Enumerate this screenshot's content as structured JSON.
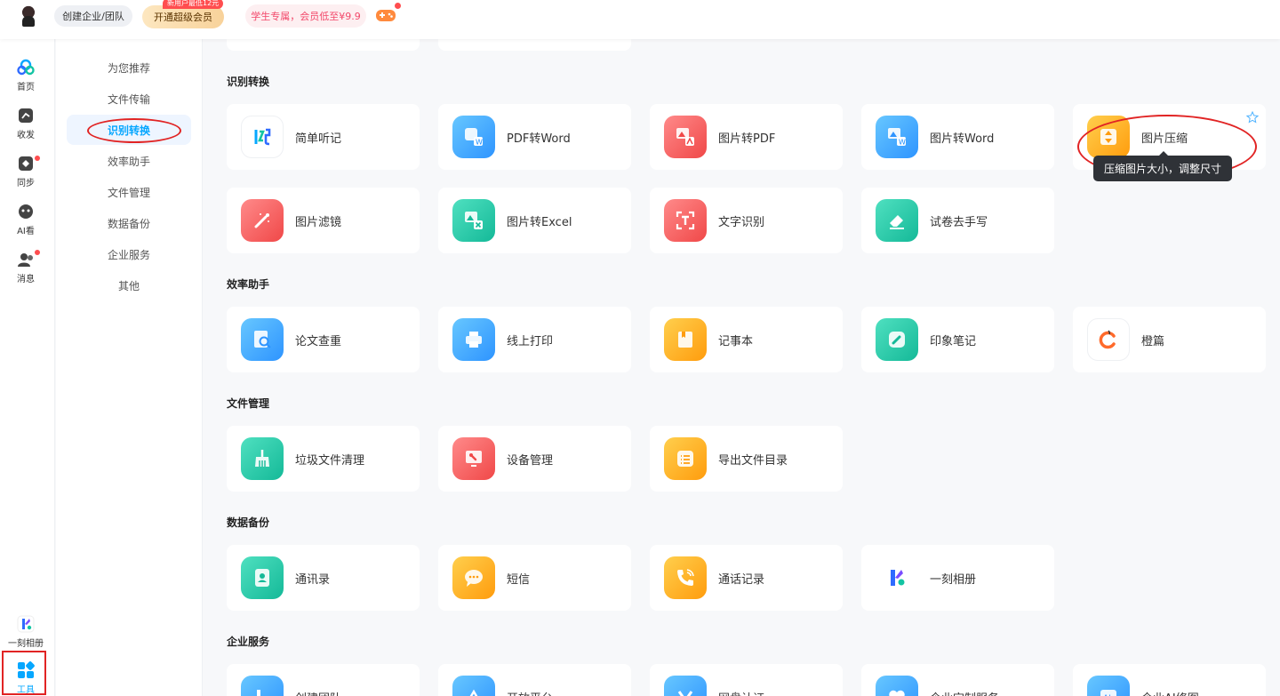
{
  "topbar": {
    "team_button": "创建企业/团队",
    "vip_button": "开通超级会员",
    "vip_badge": "新用户最低12元",
    "promo": "学生专属，会员低至¥9.9"
  },
  "rail": {
    "items": [
      {
        "label": "首页",
        "icon": "home-cloud-icon"
      },
      {
        "label": "收发",
        "icon": "share-icon"
      },
      {
        "label": "同步",
        "icon": "sync-icon"
      },
      {
        "label": "AI看",
        "icon": "ai-robot-icon"
      },
      {
        "label": "消息",
        "icon": "message-icon"
      }
    ],
    "bottom": [
      {
        "label": "一刻相册",
        "icon": "yike-album-icon"
      },
      {
        "label": "工具",
        "icon": "tools-grid-icon"
      }
    ]
  },
  "categories": [
    "为您推荐",
    "文件传输",
    "识别转换",
    "效率助手",
    "文件管理",
    "数据备份",
    "企业服务",
    "其他"
  ],
  "active_category": "识别转换",
  "sections": [
    {
      "title": "识别转换",
      "tools": [
        "简单听记",
        "PDF转Word",
        "图片转PDF",
        "图片转Word",
        "图片压缩",
        "图片滤镜",
        "图片转Excel",
        "文字识别",
        "试卷去手写"
      ]
    },
    {
      "title": "效率助手",
      "tools": [
        "论文查重",
        "线上打印",
        "记事本",
        "印象笔记",
        "橙篇"
      ]
    },
    {
      "title": "文件管理",
      "tools": [
        "垃圾文件清理",
        "设备管理",
        "导出文件目录"
      ]
    },
    {
      "title": "数据备份",
      "tools": [
        "通讯录",
        "短信",
        "通话记录",
        "一刻相册"
      ]
    },
    {
      "title": "企业服务",
      "tools": [
        "创建团队",
        "开放平台",
        "网盘认证",
        "企业定制服务",
        "企业AI修图"
      ]
    }
  ],
  "tooltip": "压缩图片大小，调整尺寸",
  "colors": {
    "accent": "#06a7ff",
    "highlight": "#e12424"
  }
}
